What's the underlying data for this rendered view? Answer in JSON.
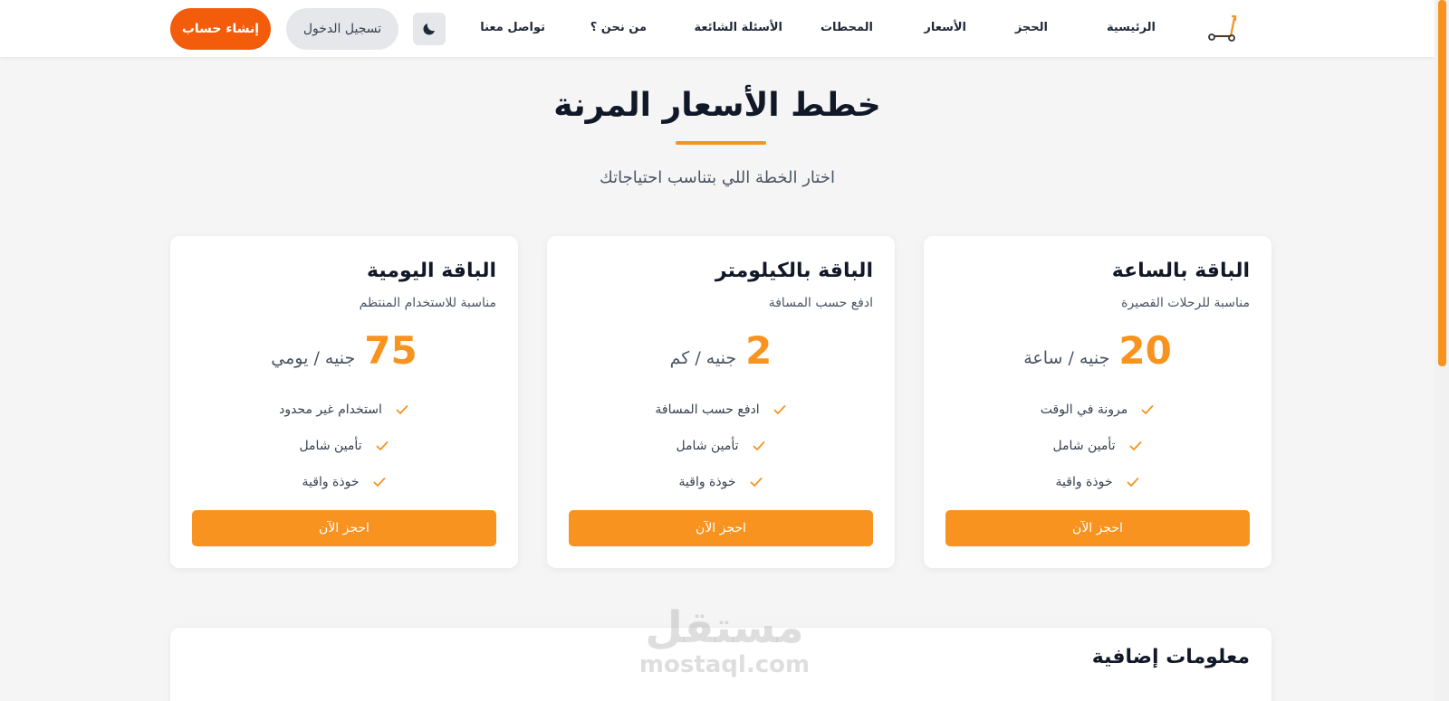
{
  "header": {
    "nav": [
      "الرئيسية",
      "الحجز",
      "الأسعار",
      "المحطات",
      "الأسئلة الشائعة",
      "من نحن ؟",
      "تواصل معنا"
    ],
    "login_label": "تسجيل الدخول",
    "signup_label": "إنشاء حساب",
    "theme_icon": "moon-icon",
    "logo_icon": "scooter-icon"
  },
  "pricing": {
    "title": "خطط الأسعار المرنة",
    "subtitle": "اختار الخطة اللي بتناسب احتياجاتك",
    "plans": [
      {
        "name": "الباقة بالساعة",
        "description": "مناسبة للرحلات القصيرة",
        "price": "20",
        "unit": "جنيه / ساعة",
        "features": [
          "مرونة في الوقت",
          "تأمين شامل",
          "خوذة واقية"
        ],
        "cta": "احجز الآن"
      },
      {
        "name": "الباقة بالكيلومتر",
        "description": "ادفع حسب المسافة",
        "price": "2",
        "unit": "جنيه / كم",
        "features": [
          "ادفع حسب المسافة",
          "تأمين شامل",
          "خوذة واقية"
        ],
        "cta": "احجز الآن"
      },
      {
        "name": "الباقة اليومية",
        "description": "مناسبة للاستخدام المنتظم",
        "price": "75",
        "unit": "جنيه / يومي",
        "features": [
          "استخدام غير محدود",
          "تأمين شامل",
          "خوذة واقية"
        ],
        "cta": "احجز الآن"
      }
    ]
  },
  "info": {
    "title": "معلومات إضافية"
  },
  "watermark": {
    "ar": "مستقل",
    "en": "mostaql.com"
  },
  "colors": {
    "accent": "#f7931e",
    "signup": "#f25c0a",
    "background": "#f5f5f5"
  }
}
